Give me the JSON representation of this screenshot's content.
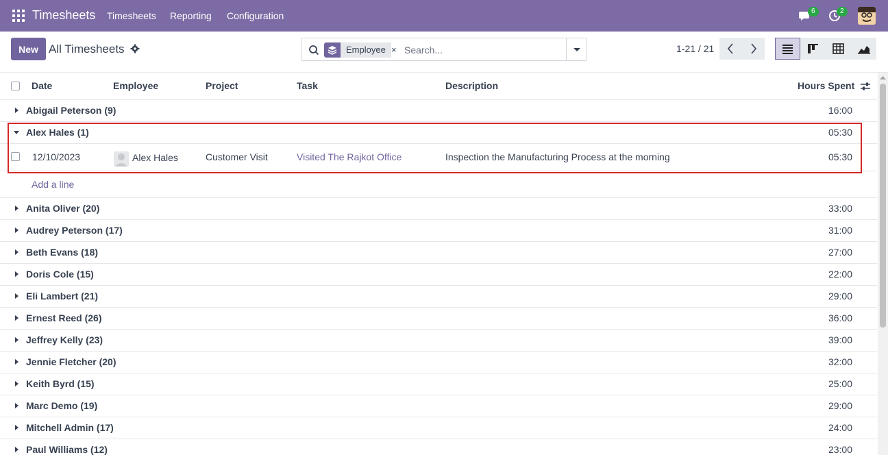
{
  "topbar": {
    "app_title": "Timesheets",
    "menu": [
      "Timesheets",
      "Reporting",
      "Configuration"
    ],
    "messages_count": "6",
    "activities_count": "2",
    "accent": "#7c6ba4"
  },
  "control": {
    "new_label": "New",
    "breadcrumb": "All Timesheets",
    "facet_label": "Employee",
    "facet_remove": "×",
    "search_placeholder": "Search...",
    "pager": "1-21 / 21"
  },
  "table": {
    "headers": [
      "Date",
      "Employee",
      "Project",
      "Task",
      "Description",
      "Hours Spent"
    ],
    "groups": [
      {
        "name": "Abigail Peterson (9)",
        "hours": "16:00",
        "expanded": false
      },
      {
        "name": "Alex Hales (1)",
        "hours": "05:30",
        "expanded": true
      },
      {
        "name": "Anita Oliver (20)",
        "hours": "33:00",
        "expanded": false
      },
      {
        "name": "Audrey Peterson (17)",
        "hours": "31:00",
        "expanded": false
      },
      {
        "name": "Beth Evans (18)",
        "hours": "27:00",
        "expanded": false
      },
      {
        "name": "Doris Cole (15)",
        "hours": "22:00",
        "expanded": false
      },
      {
        "name": "Eli Lambert (21)",
        "hours": "29:00",
        "expanded": false
      },
      {
        "name": "Ernest Reed (26)",
        "hours": "36:00",
        "expanded": false
      },
      {
        "name": "Jeffrey Kelly (23)",
        "hours": "39:00",
        "expanded": false
      },
      {
        "name": "Jennie Fletcher (20)",
        "hours": "32:00",
        "expanded": false
      },
      {
        "name": "Keith Byrd (15)",
        "hours": "25:00",
        "expanded": false
      },
      {
        "name": "Marc Demo (19)",
        "hours": "29:00",
        "expanded": false
      },
      {
        "name": "Mitchell Admin (17)",
        "hours": "24:00",
        "expanded": false
      },
      {
        "name": "Paul Williams (12)",
        "hours": "23:00",
        "expanded": false
      }
    ],
    "record": {
      "date": "12/10/2023",
      "employee": "Alex Hales",
      "project": "Customer Visit",
      "task": "Visited The Rajkot Office",
      "description": "Inspection the Manufacturing Process at the morning",
      "hours": "05:30"
    },
    "add_line": "Add a line"
  }
}
